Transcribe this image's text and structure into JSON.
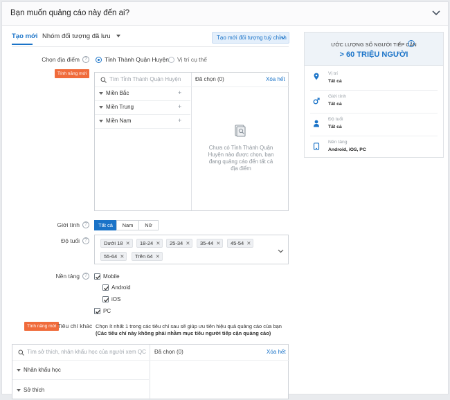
{
  "header": {
    "title": "Bạn muốn quảng cáo này đến ai?"
  },
  "tabs": {
    "new": "Tạo mới",
    "saved": "Nhóm đối tượng đã lưu",
    "custom": "Tạo mới đối tượng tuỳ chỉnh"
  },
  "location": {
    "label": "Chọn địa điểm",
    "badge": "Tính năng mới",
    "opt_province": "Tỉnh Thành Quận Huyện",
    "opt_specific": "Vị trí cụ thể",
    "search_placeholder": "Tìm Tỉnh Thành Quận Huyện",
    "selected": "Đã chọn (0)",
    "clear_all": "Xóa hết",
    "regions": [
      "Miền Bắc",
      "Miền Trung",
      "Miền Nam"
    ],
    "empty_line1": "Chưa có Tỉnh Thành Quận",
    "empty_line2": "Huyện nào được chọn, bạn",
    "empty_line3": "đang quảng cáo đến tất cả",
    "empty_line4": "địa điểm"
  },
  "gender": {
    "label": "Giới tính",
    "options": [
      "Tất cả",
      "Nam",
      "Nữ"
    ],
    "selected": "Tất cả"
  },
  "age": {
    "label": "Độ tuổi",
    "tags": [
      "Dưới 18",
      "18-24",
      "25-34",
      "35-44",
      "45-54",
      "55-64",
      "Trên 64"
    ]
  },
  "platform": {
    "label": "Nền tảng",
    "mobile": "Mobile",
    "android": "Android",
    "ios": "iOS",
    "pc": "PC"
  },
  "other": {
    "badge": "Tính năng mới",
    "label": "Tiêu chí khác",
    "desc_line1": "Chọn ít nhất 1 trong các tiêu chí sau sẽ giúp ưu tiên hiệu quả quảng cáo của bạn",
    "desc_line2": "(Các tiêu chí này không phải nhằm mục tiêu người tiếp cận quảng cáo)",
    "search_placeholder": "Tìm sở thích, nhân khẩu học của người xem QC",
    "selected": "Đã chọn (0)",
    "clear_all": "Xóa hết",
    "groups": [
      "Nhân khẩu học",
      "Sở thích"
    ]
  },
  "estimate": {
    "title": "ƯỚC LƯỢNG SỐ NGƯỜI TIẾP CẬN",
    "value": "> 60 TRIỆU NGƯỜI",
    "rows": [
      {
        "label": "Vị trí",
        "value": "Tất cả",
        "icon": "location-pin-icon"
      },
      {
        "label": "Giới tính",
        "value": "Tất cả",
        "icon": "gender-icon"
      },
      {
        "label": "Độ tuổi",
        "value": "Tất cả",
        "icon": "person-icon"
      },
      {
        "label": "Nền tảng",
        "value": "Android, iOS, PC",
        "icon": "device-icon"
      }
    ]
  },
  "colors": {
    "accent": "#1a73c8",
    "badge": "#f06b3b"
  }
}
